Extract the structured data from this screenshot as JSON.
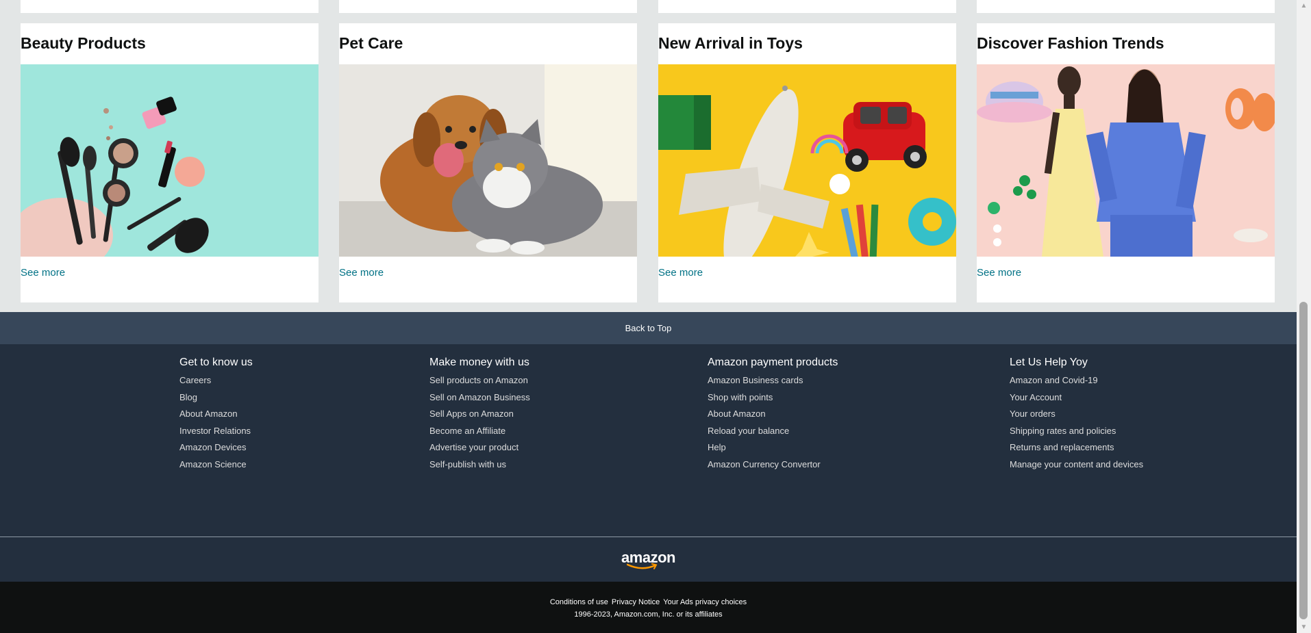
{
  "cards": [
    {
      "title": "Beauty Products",
      "link": "See more"
    },
    {
      "title": "Pet Care",
      "link": "See more"
    },
    {
      "title": "New Arrival in Toys",
      "link": "See more"
    },
    {
      "title": "Discover Fashion Trends",
      "link": "See more"
    }
  ],
  "back_to_top": "Back to Top",
  "footer": {
    "columns": [
      {
        "heading": "Get to know us",
        "links": [
          "Careers",
          "Blog",
          "About Amazon",
          "Investor Relations",
          "Amazon Devices",
          "Amazon Science"
        ]
      },
      {
        "heading": "Make money with us",
        "links": [
          "Sell products on Amazon",
          "Sell on Amazon Business",
          "Sell Apps on Amazon",
          "Become an Affiliate",
          "Advertise your product",
          "Self-publish with us"
        ]
      },
      {
        "heading": "Amazon payment products",
        "links": [
          "Amazon Business cards",
          "Shop with points",
          "About Amazon",
          "Reload your balance",
          "Help",
          "Amazon Currency Convertor"
        ]
      },
      {
        "heading": "Let Us Help Yoy",
        "links": [
          "Amazon and Covid-19",
          "Your Account",
          "Your orders",
          "Shipping rates and policies",
          "Returns and replacements",
          "Manage your content and devices"
        ]
      }
    ],
    "logo_text": "amazon",
    "legal_links": [
      "Conditions of use",
      "Privacy Notice",
      "Your Ads privacy choices"
    ],
    "copyright": "1996-2023, Amazon.com, Inc. or its affiliates"
  },
  "colors": {
    "link": "#007185",
    "back_to_top_bg": "#37475a",
    "footer_bg": "#232f3e",
    "bottom_bg": "#0f1111",
    "page_bg": "#e3e6e6"
  }
}
